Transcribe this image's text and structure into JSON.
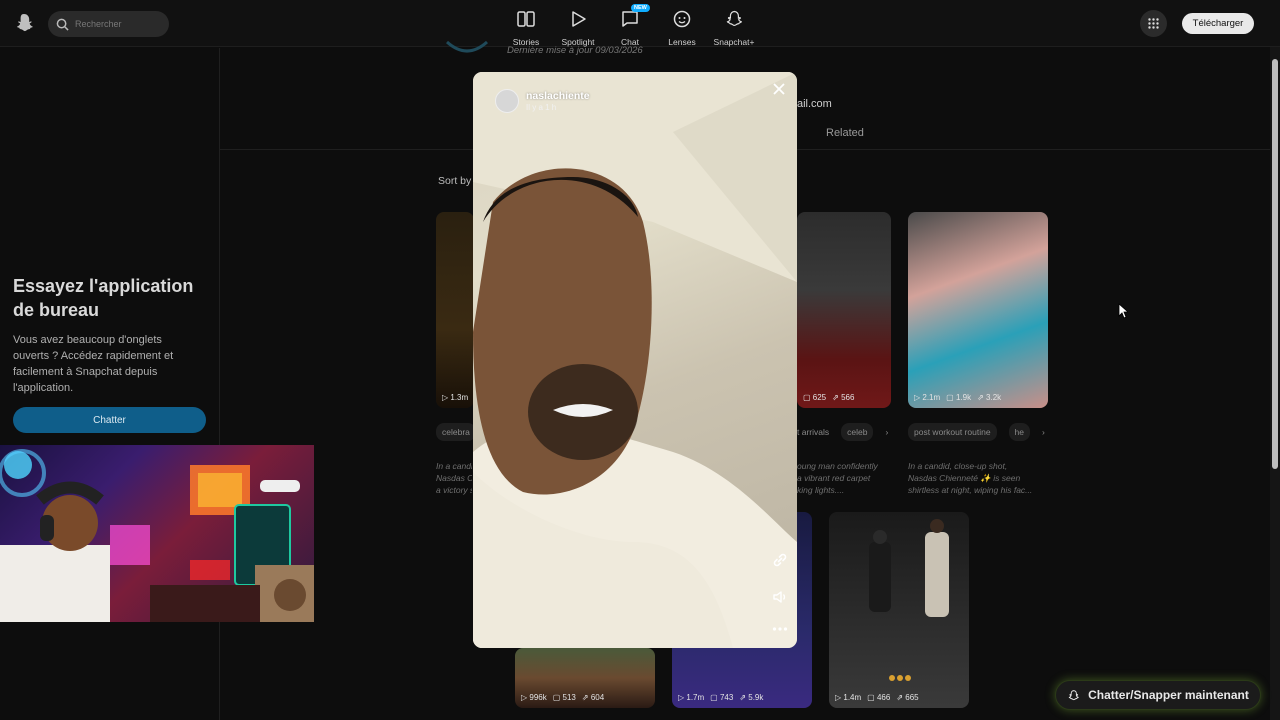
{
  "topbar": {
    "search_placeholder": "Rechercher",
    "nav": [
      {
        "label": "Stories",
        "icon": "stories-icon"
      },
      {
        "label": "Spotlight",
        "icon": "spotlight-play-icon"
      },
      {
        "label": "Chat",
        "icon": "chat-bubble-icon",
        "badge": "NEW"
      },
      {
        "label": "Lenses",
        "icon": "lenses-icon"
      },
      {
        "label": "Snapchat+",
        "icon": "ghost-icon"
      }
    ],
    "download_label": "Télécharger"
  },
  "sidebar": {
    "promo_title": "Essayez l'application de bureau",
    "promo_text": "Vous avez beaucoup d'onglets ouverts ? Accédez rapidement et facilement à Snapchat depuis l'application.",
    "chat_button": "Chatter"
  },
  "profile": {
    "updated": "Dernière mise à jour 09/03/2026",
    "email_fragment": "ail.com",
    "related_tab": "Related",
    "sort_label": "Sort by"
  },
  "cards": [
    {
      "stats": [
        "1.3m"
      ]
    },
    {
      "stats": [
        "625",
        "566"
      ]
    },
    {
      "stats": [
        "2.1m",
        "1.9k",
        "3.2k"
      ]
    },
    {
      "stats": [
        "996k",
        "513",
        "604"
      ]
    },
    {
      "stats": [
        "1.7m",
        "743",
        "5.9k"
      ]
    },
    {
      "stats": [
        "1.4m",
        "466",
        "665"
      ]
    }
  ],
  "tags": {
    "left": [
      "celebra"
    ],
    "mid": [
      "t arrivals",
      "celeb"
    ],
    "right": [
      "post workout routine",
      "he"
    ]
  },
  "descriptions": {
    "left": "In a candi\nNasdas C\na victory s",
    "mid": "oung man confidently\na vibrant red carpet\nking lights....",
    "right": "In a candid, close-up shot,\nNasdas Chienneté ✨ is seen\nshirtless at night, wiping his fac..."
  },
  "modal": {
    "username": "naslachiente",
    "time": "Il y a 1 h"
  },
  "cta_label": "Chatter/Snapper maintenant"
}
